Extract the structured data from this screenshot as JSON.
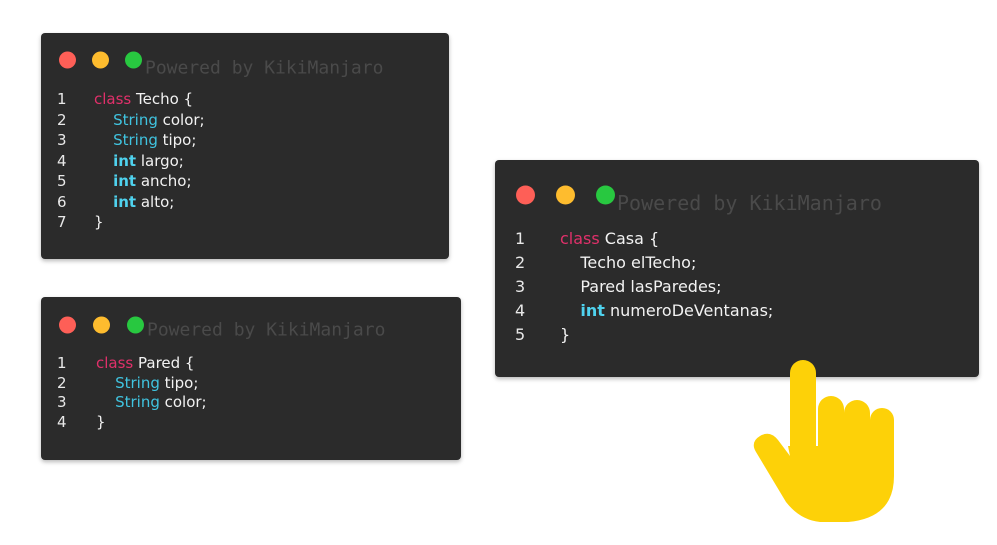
{
  "colors": {
    "window_bg": "#2b2b2b",
    "dot_red": "#fe5f57",
    "dot_yellow": "#febc2e",
    "dot_green": "#28c840",
    "keyword": "#e0306a",
    "type": "#40c4e0",
    "primitive": "#4fd2ee",
    "hand": "#fdd108"
  },
  "windows": [
    {
      "watermark": "Powered by KikiManjaro",
      "lines": [
        {
          "n": "1",
          "parts": [
            {
              "t": "class",
              "c": "kw"
            },
            {
              "t": " Techo {",
              "c": "pl"
            }
          ]
        },
        {
          "n": "2",
          "parts": [
            {
              "t": "    ",
              "c": "pl"
            },
            {
              "t": "String",
              "c": "ty"
            },
            {
              "t": " color;",
              "c": "pl"
            }
          ]
        },
        {
          "n": "3",
          "parts": [
            {
              "t": "    ",
              "c": "pl"
            },
            {
              "t": "String",
              "c": "ty"
            },
            {
              "t": " tipo;",
              "c": "pl"
            }
          ]
        },
        {
          "n": "4",
          "parts": [
            {
              "t": "    ",
              "c": "pl"
            },
            {
              "t": "int",
              "c": "pr"
            },
            {
              "t": " largo;",
              "c": "pl"
            }
          ]
        },
        {
          "n": "5",
          "parts": [
            {
              "t": "    ",
              "c": "pl"
            },
            {
              "t": "int",
              "c": "pr"
            },
            {
              "t": " ancho;",
              "c": "pl"
            }
          ]
        },
        {
          "n": "6",
          "parts": [
            {
              "t": "    ",
              "c": "pl"
            },
            {
              "t": "int",
              "c": "pr"
            },
            {
              "t": " alto;",
              "c": "pl"
            }
          ]
        },
        {
          "n": "7",
          "parts": [
            {
              "t": "}",
              "c": "pl"
            }
          ]
        }
      ]
    },
    {
      "watermark": "Powered by KikiManjaro",
      "lines": [
        {
          "n": "1",
          "parts": [
            {
              "t": "class",
              "c": "kw"
            },
            {
              "t": " Pared {",
              "c": "pl"
            }
          ]
        },
        {
          "n": "2",
          "parts": [
            {
              "t": "    ",
              "c": "pl"
            },
            {
              "t": "String",
              "c": "ty"
            },
            {
              "t": " tipo;",
              "c": "pl"
            }
          ]
        },
        {
          "n": "3",
          "parts": [
            {
              "t": "    ",
              "c": "pl"
            },
            {
              "t": "String",
              "c": "ty"
            },
            {
              "t": " color;",
              "c": "pl"
            }
          ]
        },
        {
          "n": "4",
          "parts": [
            {
              "t": "}",
              "c": "pl"
            }
          ]
        }
      ]
    },
    {
      "watermark": "Powered by KikiManjaro",
      "lines": [
        {
          "n": "1",
          "parts": [
            {
              "t": "class",
              "c": "kw"
            },
            {
              "t": " Casa {",
              "c": "pl"
            }
          ]
        },
        {
          "n": "2",
          "parts": [
            {
              "t": "    Techo elTecho;",
              "c": "pl"
            }
          ]
        },
        {
          "n": "3",
          "parts": [
            {
              "t": "    Pared lasParedes;",
              "c": "pl"
            }
          ]
        },
        {
          "n": "4",
          "parts": [
            {
              "t": "    ",
              "c": "pl"
            },
            {
              "t": "int",
              "c": "pr"
            },
            {
              "t": " numeroDeVentanas;",
              "c": "pl"
            }
          ]
        },
        {
          "n": "5",
          "parts": [
            {
              "t": "}",
              "c": "pl"
            }
          ]
        }
      ]
    }
  ],
  "decoration": {
    "icon": "pointing-hand-icon"
  }
}
